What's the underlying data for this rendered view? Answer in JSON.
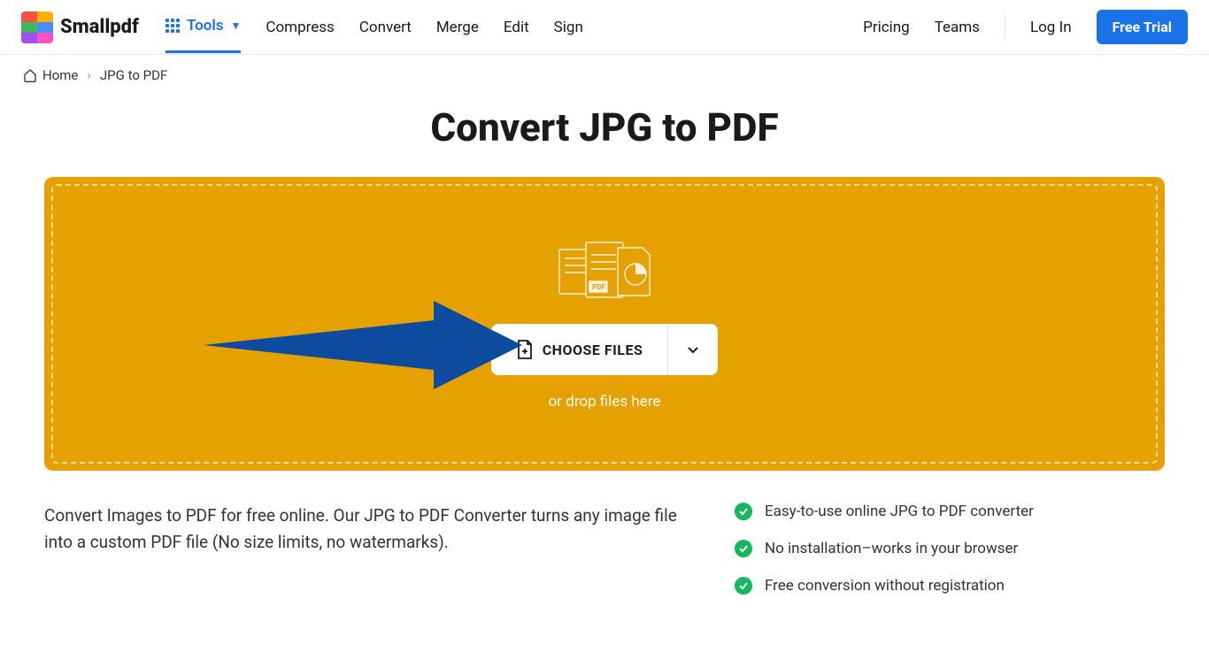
{
  "header": {
    "brand": "Smallpdf",
    "nav": {
      "tools": "Tools",
      "compress": "Compress",
      "convert": "Convert",
      "merge": "Merge",
      "edit": "Edit",
      "sign": "Sign"
    },
    "right": {
      "pricing": "Pricing",
      "teams": "Teams",
      "login": "Log In",
      "trial": "Free Trial"
    }
  },
  "breadcrumb": {
    "home": "Home",
    "current": "JPG to PDF"
  },
  "title": "Convert JPG to PDF",
  "dropzone": {
    "choose": "CHOOSE FILES",
    "drop": "or drop files here"
  },
  "description": "Convert Images to PDF for free online. Our JPG to PDF Converter turns any image file into a custom PDF file (No size limits, no watermarks).",
  "features": [
    "Easy-to-use online JPG to PDF converter",
    "No installation–works in your browser",
    "Free conversion without registration"
  ],
  "colors": {
    "accent": "#1a73e8",
    "dropzone": "#e5a100",
    "success": "#14b85f",
    "arrow": "#0d4b9e"
  }
}
